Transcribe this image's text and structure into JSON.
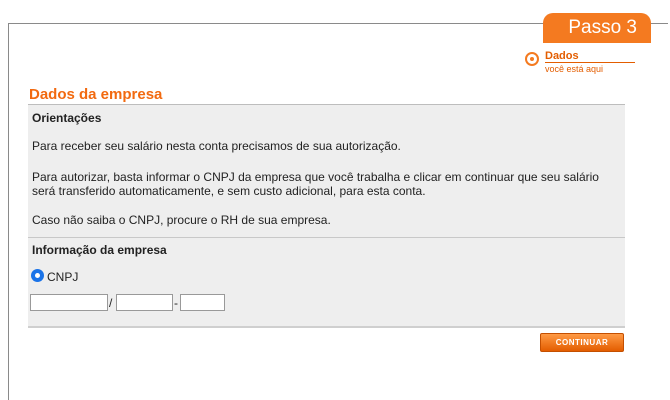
{
  "header": {
    "step_badge": "Passo 3"
  },
  "step": {
    "name": "Dados",
    "sub": "você está aqui"
  },
  "page": {
    "title": "Dados da empresa"
  },
  "guidance": {
    "heading": "Orientações",
    "p1": "Para receber seu salário nesta conta precisamos de sua autorização.",
    "p2": "Para autorizar, basta informar o CNPJ da empresa que você trabalha e clicar em continuar que seu salário será transferido automaticamente, e sem custo adicional, para esta conta.",
    "p3": "Caso não saiba o CNPJ, procure o RH de sua empresa."
  },
  "company": {
    "heading": "Informação da empresa",
    "radio_label": "CNPJ",
    "sep_slash": "/",
    "sep_dash": "-",
    "cnpj_part1": "",
    "cnpj_part2": "",
    "cnpj_part3": ""
  },
  "actions": {
    "continue_label": "CONTINUAR"
  },
  "colors": {
    "accent": "#f47a20",
    "title": "#f26a10",
    "panel": "#eeeeee"
  }
}
